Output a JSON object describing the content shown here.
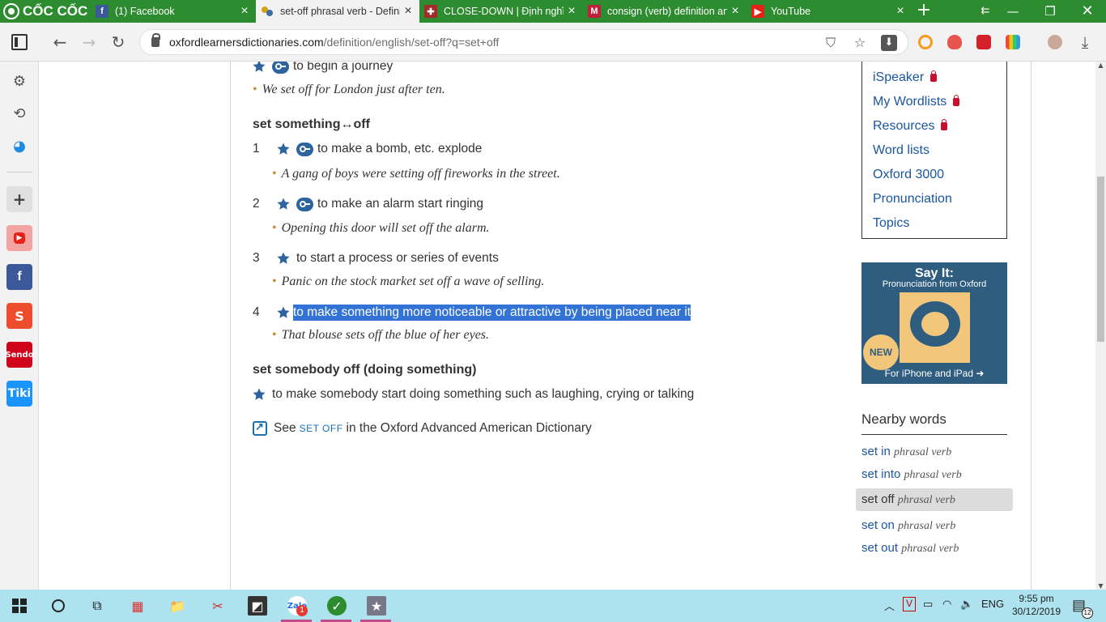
{
  "browser": {
    "brand": "CỐC CỐC",
    "tabs": [
      {
        "title": "(1) Facebook",
        "icon": "facebook-icon"
      },
      {
        "title": "set-off phrasal verb - Defini",
        "icon": "oxford-icon"
      },
      {
        "title": "CLOSE-DOWN | Định nghĩa",
        "icon": "cambridge-icon"
      },
      {
        "title": "consign (verb) definition an",
        "icon": "macmillan-icon"
      },
      {
        "title": "YouTube",
        "icon": "youtube-icon"
      }
    ],
    "url_domain": "oxfordlearnersdictionaries.com",
    "url_path": "/definition/english/set-off?q=set+off"
  },
  "entry": {
    "top_sense": "to begin a journey",
    "top_example": "We set off for London just after ten.",
    "pv1_head": "set something↔off",
    "senses": [
      {
        "num": "1",
        "text": "to make a bomb, etc. explode",
        "example": "A gang of boys were setting off fireworks in the street.",
        "key": true
      },
      {
        "num": "2",
        "text": "to make an alarm start ringing",
        "example": "Opening this door will set off the alarm.",
        "key": true
      },
      {
        "num": "3",
        "text": "to start a process or series of events",
        "example": "Panic on the stock market set off a wave of selling.",
        "key": false
      },
      {
        "num": "4",
        "text": "to make something more noticeable or attractive by being placed near it",
        "example": "That blouse sets off the blue of her eyes.",
        "key": false
      }
    ],
    "pv2_head": "set somebody off (doing something)",
    "pv2_sense": "to make somebody start doing something such as laughing, crying or talking",
    "see_prefix": "See",
    "see_link": "SET OFF",
    "see_suffix": "in the Oxford Advanced American Dictionary"
  },
  "right": {
    "links": [
      "iSpeaker",
      "My Wordlists",
      "Resources",
      "Word lists",
      "Oxford 3000",
      "Pronunciation",
      "Topics"
    ],
    "promo_title": "Say It:",
    "promo_sub": "Pronunciation from Oxford",
    "promo_badge": "NEW",
    "promo_footer": "For iPhone and iPad",
    "nearby_title": "Nearby words",
    "nearby": [
      {
        "word": "set in",
        "pos": "phrasal verb"
      },
      {
        "word": "set into",
        "pos": "phrasal verb"
      },
      {
        "word": "set off",
        "pos": "phrasal verb"
      },
      {
        "word": "set on",
        "pos": "phrasal verb"
      },
      {
        "word": "set out",
        "pos": "phrasal verb"
      }
    ]
  },
  "taskbar": {
    "lang": "ENG",
    "time": "9:55 pm",
    "date": "30/12/2019",
    "notif_count": "12",
    "zalo_badge": "1"
  },
  "colors": {
    "browser_green": "#2d8b30",
    "link_blue": "#1a56a0",
    "highlight": "#3373d6",
    "star_blue": "#2d64a0"
  }
}
